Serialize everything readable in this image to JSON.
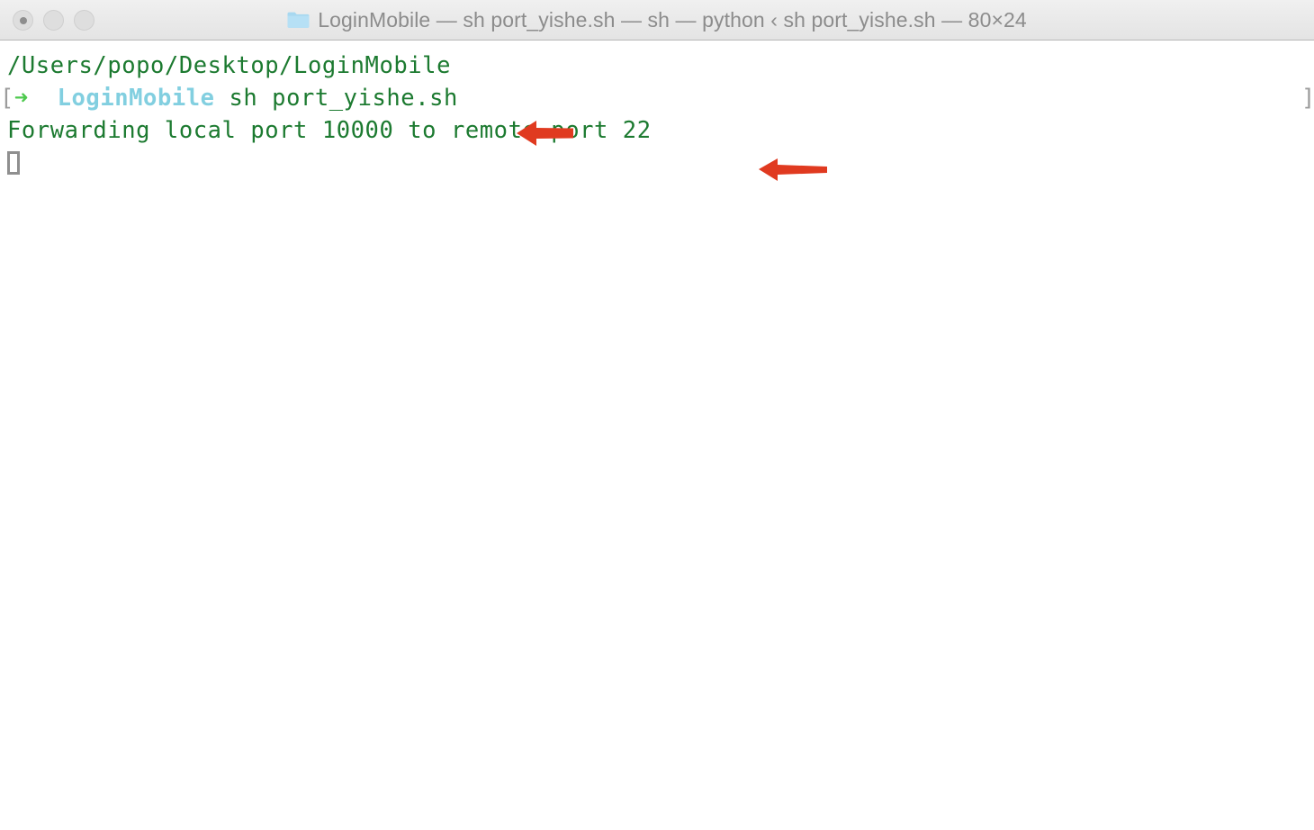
{
  "window": {
    "title": "LoginMobile — sh port_yishe.sh — sh — python ‹ sh port_yishe.sh — 80×24",
    "folder_icon": "folder-icon",
    "size_spec": "80×24",
    "traffic_lights": {
      "close_label": "close",
      "minimize_label": "minimize",
      "zoom_label": "zoom"
    }
  },
  "terminal": {
    "background_color": "#ffffff",
    "text_color": "#1c7a30",
    "prompt_host_color": "#82cfe0",
    "prompt_arrow_color": "#4ec94e",
    "bracket_color": "#9c9c9c",
    "cursor_color": "#8f8f8f",
    "lines": {
      "cwd": "/Users/popo/Desktop/LoginMobile",
      "prompt_left_bracket": "[",
      "prompt_arrow": "➜",
      "prompt_dir": "LoginMobile",
      "prompt_command": "sh port_yishe.sh",
      "prompt_right_bracket": "]",
      "output": "Forwarding local port 10000 to remote port 22"
    },
    "cursor": {
      "name": "block-cursor",
      "style": "hollow"
    }
  },
  "annotations": {
    "color": "#e03a20",
    "arrows": [
      {
        "name": "arrow-pointing-at-command",
        "direction": "left",
        "target": "sh port_yishe.sh"
      },
      {
        "name": "arrow-pointing-at-output",
        "direction": "left",
        "target": "Forwarding local port 10000 to remote port 22"
      }
    ]
  }
}
